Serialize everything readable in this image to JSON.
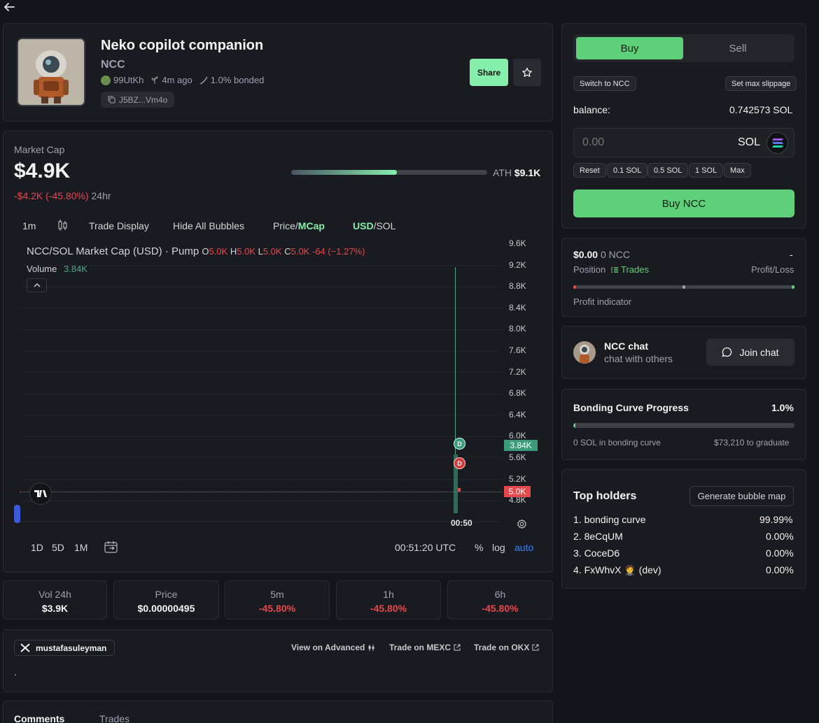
{
  "token": {
    "name": "Neko copilot companion",
    "ticker": "NCC",
    "creator": "99UtKh",
    "age": "4m ago",
    "bonded": "1.0% bonded",
    "contract": "J5BZ...Vm4o",
    "share_label": "Share"
  },
  "market": {
    "label": "Market Cap",
    "value": "$4.9K",
    "change": "-$4.2K (-45.80%)",
    "change_period": "24hr",
    "ath_label": "ATH",
    "ath_value": "$9.1K",
    "ath_progress": 0.54
  },
  "toolbar": {
    "interval": "1m",
    "trade_display": "Trade Display",
    "hide_bubbles": "Hide All Bubbles",
    "price_label": "Price/",
    "mcap_label": "MCap",
    "usd_label": "USD",
    "sol_label": "/SOL"
  },
  "chart": {
    "pair_title": "NCC/SOL Market Cap (USD) · Pump",
    "o_label": "O",
    "o": "5.0K",
    "h_label": "H",
    "h": "5.0K",
    "l_label": "L",
    "l": "5.0K",
    "c_label": "C",
    "c": "5.0K",
    "change": "-64 (−1.27%)",
    "volume_label": "Volume",
    "volume": "3.84K",
    "yticks": [
      "9.6K",
      "9.2K",
      "8.8K",
      "8.4K",
      "8.0K",
      "7.6K",
      "7.2K",
      "6.8K",
      "6.4K",
      "6.0K",
      "5.6K",
      "5.2K",
      "4.8K"
    ],
    "volume_badge": "3.84K",
    "price_badge": "5.0K",
    "time_label": "00:50",
    "bubble_label": "D",
    "ranges": [
      "1D",
      "5D",
      "1M"
    ],
    "clock": "00:51:20 UTC",
    "pct": "%",
    "log": "log",
    "auto": "auto"
  },
  "stats": [
    {
      "label": "Vol 24h",
      "value": "$3.9K"
    },
    {
      "label": "Price",
      "value": "$0.00000495"
    },
    {
      "label": "5m",
      "value": "-45.80%"
    },
    {
      "label": "1h",
      "value": "-45.80%"
    },
    {
      "label": "6h",
      "value": "-45.80%"
    }
  ],
  "social": {
    "handle": "mustafasuleyman",
    "advanced": "View on Advanced",
    "mexc": "Trade on MEXC",
    "okx": "Trade on OKX",
    "description": "."
  },
  "tabs": {
    "comments": "Comments",
    "trades": "Trades"
  },
  "trade": {
    "buy_tab": "Buy",
    "sell_tab": "Sell",
    "switch": "Switch to NCC",
    "slippage": "Set max slippage",
    "balance_label": "balance:",
    "balance": "0.742573 SOL",
    "amount_placeholder": "0.00",
    "currency": "SOL",
    "quick": [
      "Reset",
      "0.1 SOL",
      "0.5 SOL",
      "1 SOL",
      "Max"
    ],
    "buy_button": "Buy NCC"
  },
  "position": {
    "value": "$0.00",
    "amount": "0 NCC",
    "pnl": "-",
    "position_label": "Position",
    "trades_label": "Trades",
    "pnl_label": "Profit/Loss",
    "indicator_label": "Profit indicator"
  },
  "chat": {
    "title": "NCC chat",
    "subtitle": "chat with others",
    "join": "Join chat"
  },
  "bonding": {
    "title": "Bonding Curve Progress",
    "percent": "1.0%",
    "progress": 0.01,
    "in_curve": "0 SOL in bonding curve",
    "to_graduate": "$73,210 to graduate"
  },
  "holders": {
    "title": "Top holders",
    "bubble_map": "Generate bubble map",
    "list": [
      {
        "name": "1. bonding curve",
        "pct": "99.99%"
      },
      {
        "name": "2. 8eCqUM",
        "pct": "0.00%"
      },
      {
        "name": "3. CoceD6",
        "pct": "0.00%"
      },
      {
        "name": "4. FxWhvX 🤵 (dev)",
        "pct": "0.00%"
      }
    ]
  },
  "colors": {
    "accent": "#5fd07a",
    "up": "#86efac",
    "down": "#e5484d"
  }
}
